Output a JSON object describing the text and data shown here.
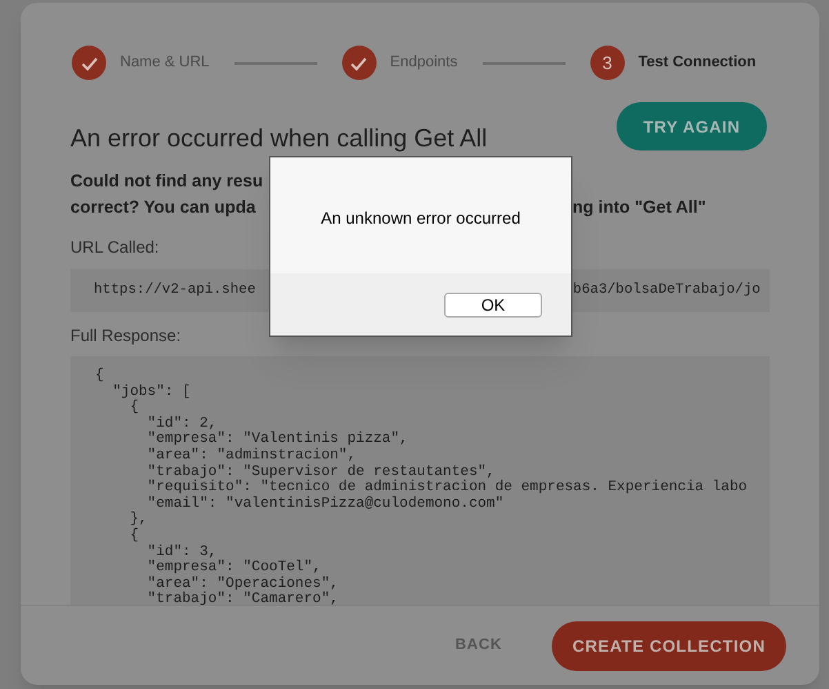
{
  "steps": [
    {
      "label": "Name & URL",
      "completed": true
    },
    {
      "label": "Endpoints",
      "completed": true
    },
    {
      "label": "Test Connection",
      "completed": false,
      "number": "3"
    }
  ],
  "error": {
    "title": "An error occurred when calling Get All",
    "message_lines": [
      [
        "Could not find any resu"
      ],
      [
        "correct? You can upda",
        "ng into \"Get All\""
      ]
    ]
  },
  "try_again": "TRY AGAIN",
  "url_label": "URL Called:",
  "url_parts": [
    "https://v2-api.shee",
    "b6a3/bolsaDeTrabajo/jo"
  ],
  "response_label": "Full Response:",
  "response_lines": [
    "{",
    "  \"jobs\": [",
    "    {",
    "      \"id\": 2,",
    "      \"empresa\": \"Valentinis pizza\",",
    "      \"area\": \"adminstracion\",",
    "      \"trabajo\": \"Supervisor de restautantes\",",
    "      \"requisito\": \"tecnico de administracion de empresas. Experiencia labo",
    "      \"email\": \"valentinisPizza@culodemono.com\"",
    "    },",
    "    {",
    "      \"id\": 3,",
    "      \"empresa\": \"CooTel\",",
    "      \"area\": \"Operaciones\",",
    "      \"trabajo\": \"Camarero\","
  ],
  "footer": {
    "back": "BACK",
    "create": "CREATE COLLECTION"
  },
  "alert": {
    "message": "An unknown error occurred",
    "button": "OK"
  }
}
